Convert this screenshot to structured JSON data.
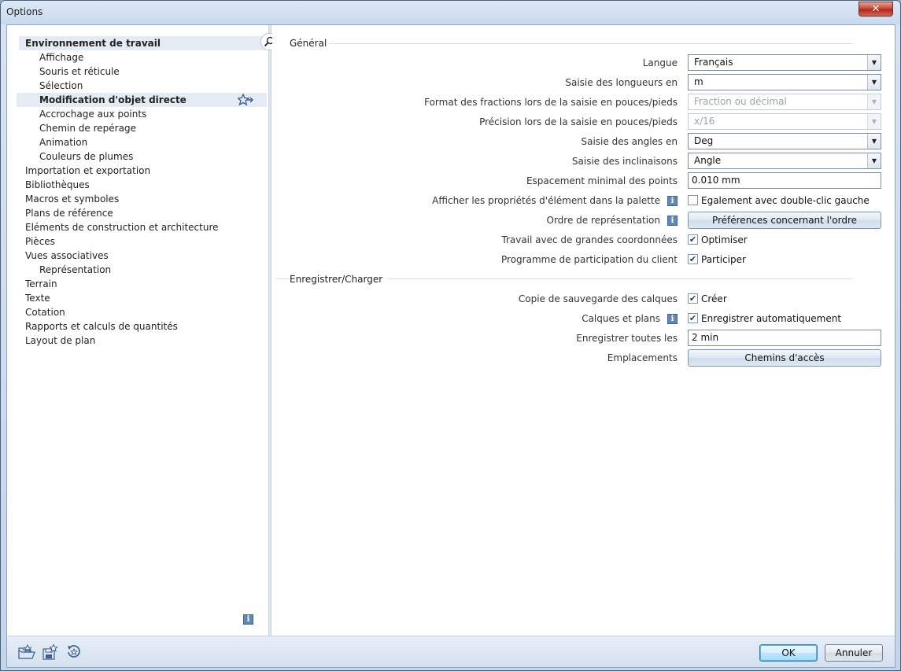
{
  "window": {
    "title": "Options",
    "close_label": "✕"
  },
  "tree": {
    "items": [
      {
        "label": "Environnement de travail"
      },
      {
        "label": "Affichage"
      },
      {
        "label": "Souris et réticule"
      },
      {
        "label": "Sélection"
      },
      {
        "label": "Modification d'objet directe"
      },
      {
        "label": "Accrochage aux points"
      },
      {
        "label": "Chemin de repérage"
      },
      {
        "label": "Animation"
      },
      {
        "label": "Couleurs de plumes"
      },
      {
        "label": "Importation et exportation"
      },
      {
        "label": "Bibliothèques"
      },
      {
        "label": "Macros et symboles"
      },
      {
        "label": "Plans de référence"
      },
      {
        "label": "Eléments de construction et architecture"
      },
      {
        "label": "Pièces"
      },
      {
        "label": "Vues associatives"
      },
      {
        "label": "Représentation"
      },
      {
        "label": "Terrain"
      },
      {
        "label": "Texte"
      },
      {
        "label": "Cotation"
      },
      {
        "label": "Rapports et calculs de quantités"
      },
      {
        "label": "Layout de plan"
      }
    ]
  },
  "general": {
    "title": "Général",
    "langue_label": "Langue",
    "langue_value": "Français",
    "longueurs_label": "Saisie des longueurs en",
    "longueurs_value": "m",
    "fractions_label": "Format des fractions lors de la saisie en pouces/pieds",
    "fractions_value": "Fraction ou décimal",
    "precision_label": "Précision lors de la saisie en pouces/pieds",
    "precision_value": "x/16",
    "angles_label": "Saisie des angles en",
    "angles_value": "Deg",
    "inclinaisons_label": "Saisie des inclinaisons",
    "inclinaisons_value": "Angle",
    "espacement_label": "Espacement minimal des points",
    "espacement_value": "0.010 mm",
    "proprietes_label": "Afficher les propriétés d'élément dans la palette",
    "proprietes_check": "Egalement avec double-clic gauche",
    "ordre_label": "Ordre de représentation",
    "ordre_button": "Préférences concernant l'ordre",
    "coord_label": "Travail avec de grandes coordonnées",
    "coord_check": "Optimiser",
    "programme_label": "Programme de participation du client",
    "programme_check": "Participer"
  },
  "save": {
    "title": "Enregistrer/Charger",
    "copie_label": "Copie de sauvegarde des calques",
    "copie_check": "Créer",
    "calques_label": "Calques et plans",
    "calques_check": "Enregistrer automatiquement",
    "toutes_label": "Enregistrer toutes les",
    "toutes_value": "2 min",
    "emplacements_label": "Emplacements",
    "emplacements_button": "Chemins d'accès"
  },
  "check_mark": "✔",
  "info_glyph": "i",
  "arrow_glyph": "▼",
  "footer": {
    "ok": "OK",
    "cancel": "Annuler"
  }
}
